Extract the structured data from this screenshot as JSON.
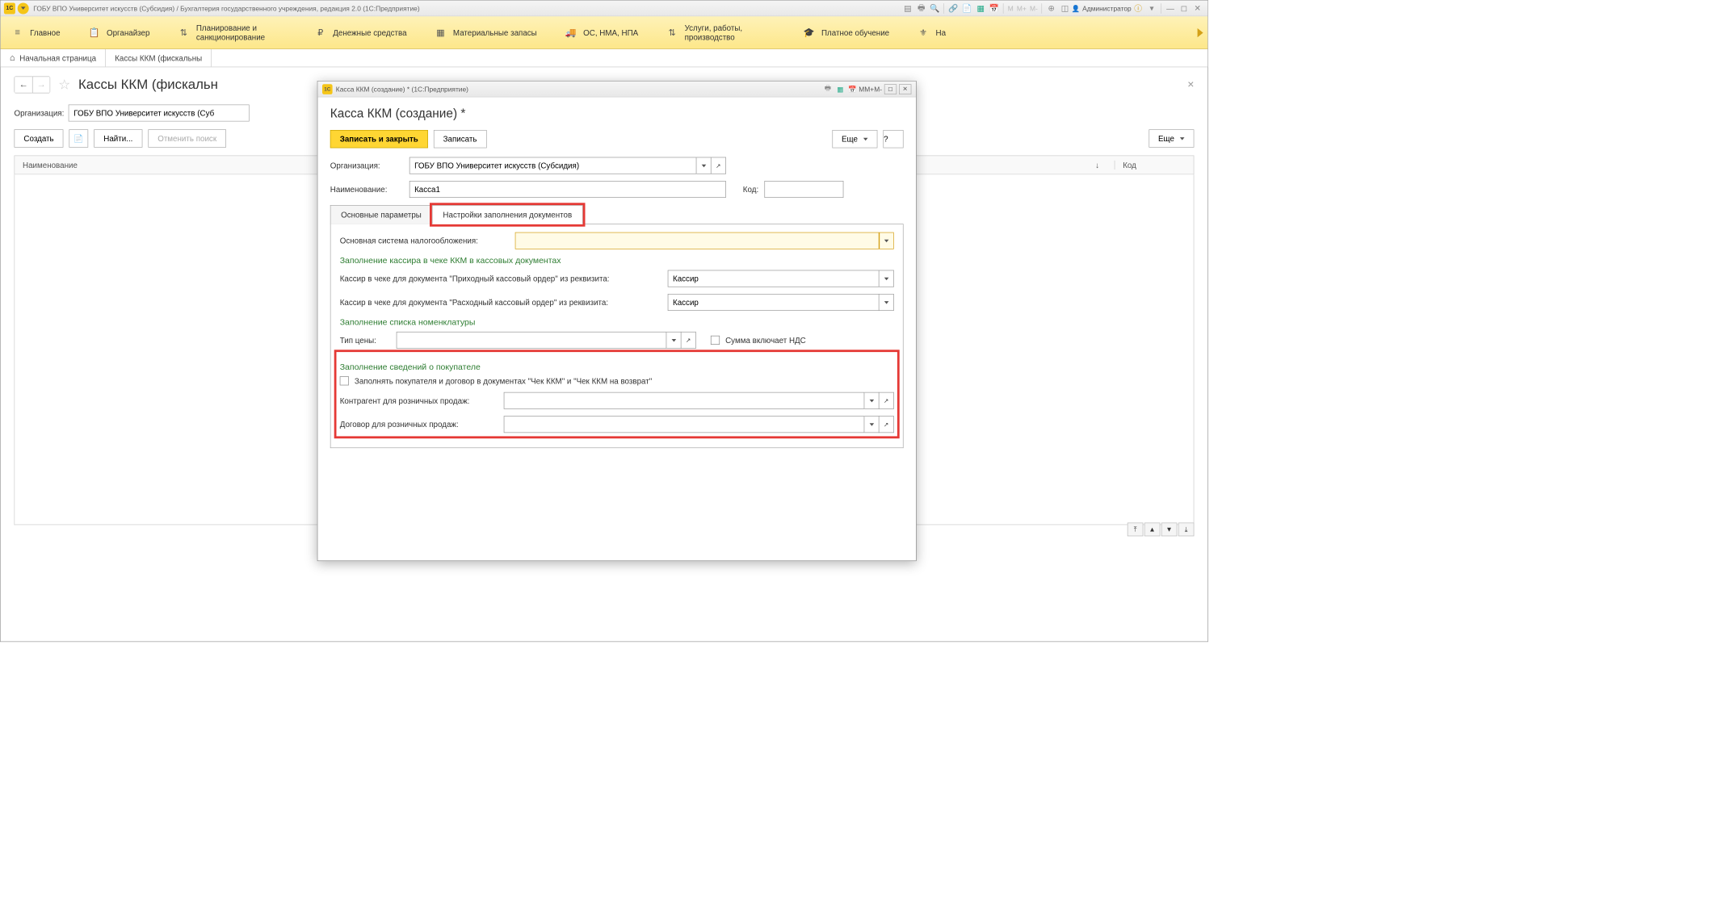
{
  "titlebar": {
    "app_badge": "1C",
    "title": "ГОБУ ВПО Университет искусств (Субсидия) / Бухгалтерия государственного учреждения, редакция 2.0  (1С:Предприятие)",
    "m_labels": [
      "M",
      "M+",
      "M-"
    ],
    "user_label": "Администратор"
  },
  "mainnav": {
    "items": [
      "Главное",
      "Органайзер",
      "Планирование и санкционирование",
      "Денежные средства",
      "Материальные запасы",
      "ОС, НМА, НПА",
      "Услуги, работы, производство",
      "Платное обучение",
      "На"
    ]
  },
  "tabs_top": {
    "home": "Начальная страница",
    "current": "Кассы ККМ (фискальны"
  },
  "page": {
    "title": "Кассы ККМ (фискальн",
    "org_label": "Организация:",
    "org_value": "ГОБУ ВПО Университет искусств (Суб",
    "create": "Создать",
    "find": "Найти...",
    "cancel_search": "Отменить поиск",
    "more": "Еще",
    "col_name": "Наименование",
    "col_code": "Код",
    "col_arrow": "↓"
  },
  "modal": {
    "win_title": "Касса ККМ (создание) *  (1С:Предприятие)",
    "m_labels": [
      "M",
      "M+",
      "M-"
    ],
    "title": "Касса ККМ (создание) *",
    "save_close": "Записать и закрыть",
    "save": "Записать",
    "more": "Еще",
    "help": "?",
    "org_label": "Организация:",
    "org_value": "ГОБУ ВПО Университет искусств (Субсидия)",
    "name_label": "Наименование:",
    "name_value": "Касса1",
    "code_label": "Код:",
    "code_value": "",
    "tab1": "Основные параметры",
    "tab2": "Настройки заполнения документов",
    "tax_label": "Основная система налогообложения:",
    "tax_value": "",
    "sec1_title": "Заполнение кассира в чеке ККМ в кассовых документах",
    "cashier_in_label": "Кассир в чеке для документа \"Приходный кассовый ордер\" из реквизита:",
    "cashier_in_value": "Кассир",
    "cashier_out_label": "Кассир в чеке для документа \"Расходный кассовый ордер\" из реквизита:",
    "cashier_out_value": "Кассир",
    "sec2_title": "Заполнение списка номенклатуры",
    "price_type_label": "Тип цены:",
    "price_type_value": "",
    "vat_cb_label": "Сумма включает НДС",
    "sec3_title": "Заполнение сведений о покупателе",
    "fill_buyer_cb": "Заполнять покупателя и договор в документах \"Чек ККМ\" и \"Чек ККМ на возврат\"",
    "contragent_label": "Контрагент для розничных продаж:",
    "contragent_value": "",
    "contract_label": "Договор для розничных продаж:",
    "contract_value": ""
  }
}
